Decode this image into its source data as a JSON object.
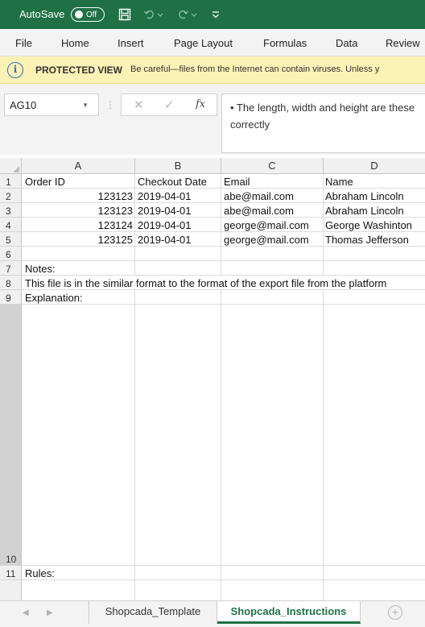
{
  "titlebar": {
    "autosave_label": "AutoSave",
    "toggle_state": "Off",
    "quick_access_icons": [
      "save-icon",
      "undo-icon",
      "redo-icon",
      "customize-icon"
    ]
  },
  "ribbon": {
    "tabs": [
      "File",
      "Home",
      "Insert",
      "Page Layout",
      "Formulas",
      "Data",
      "Review"
    ]
  },
  "protected_view": {
    "title": "PROTECTED VIEW",
    "message": "Be careful—files from the Internet can contain viruses. Unless y",
    "icon": "info-icon"
  },
  "formula_bar": {
    "name_box": "AG10",
    "fx_label": "fx",
    "content": "• The length, width and height are these correctly"
  },
  "columns": [
    "A",
    "B",
    "C",
    "D"
  ],
  "rows": [
    "1",
    "2",
    "3",
    "4",
    "5",
    "6",
    "7",
    "8",
    "9",
    "10",
    "11"
  ],
  "cells": {
    "header": [
      "Order ID",
      "Checkout Date",
      "Email",
      "Name"
    ],
    "data": [
      [
        "123123",
        "2019-04-01",
        "abe@mail.com",
        "Abraham Lincoln"
      ],
      [
        "123123",
        "2019-04-01",
        "abe@mail.com",
        "Abraham Lincoln"
      ],
      [
        "123124",
        "2019-04-01",
        "george@mail.com",
        "George Washinton"
      ],
      [
        "123125",
        "2019-04-01",
        "george@mail.com",
        "Thomas Jefferson"
      ]
    ],
    "a7": "Notes:",
    "a8": "This file is in the similar format to the format of the export file from the platform",
    "a9": "Explanation:",
    "a11": "Rules:"
  },
  "sheet_tabs": [
    "Shopcada_Template",
    "Shopcada_Instructions"
  ],
  "active_sheet": "Shopcada_Instructions",
  "colors": {
    "excel_green": "#1f7145",
    "protected_view_bg": "#fdf2b6"
  }
}
